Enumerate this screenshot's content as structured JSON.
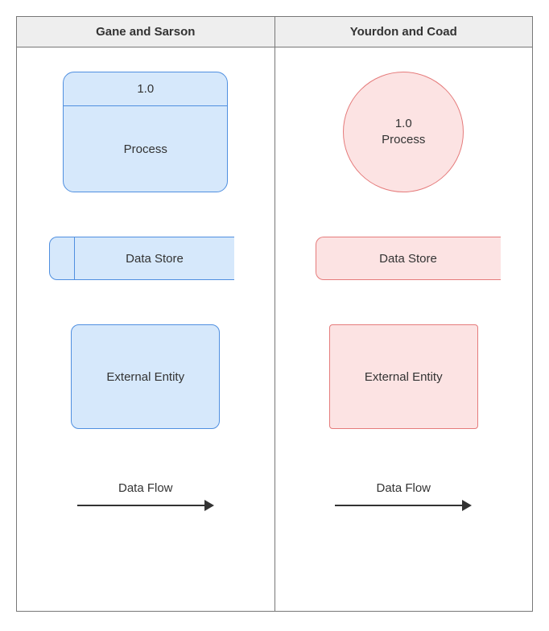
{
  "headers": {
    "left": "Gane and Sarson",
    "right": "Yourdon and Coad"
  },
  "gane_sarson": {
    "process_number": "1.0",
    "process_label": "Process",
    "datastore_label": "Data Store",
    "entity_label": "External Entity",
    "flow_label": "Data Flow"
  },
  "yourdon_coad": {
    "process_number": "1.0",
    "process_label": "Process",
    "datastore_label": "Data Store",
    "entity_label": "External Entity",
    "flow_label": "Data Flow"
  }
}
